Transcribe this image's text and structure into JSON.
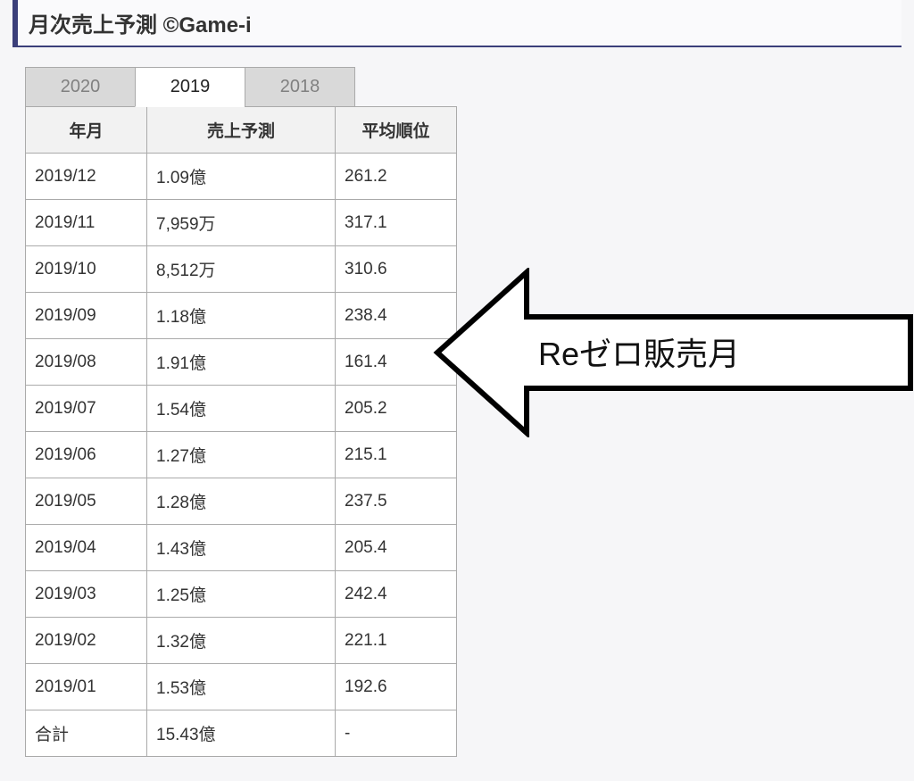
{
  "title": "月次売上予測 ©Game-i",
  "tabs": [
    {
      "label": "2020",
      "active": false
    },
    {
      "label": "2019",
      "active": true
    },
    {
      "label": "2018",
      "active": false
    }
  ],
  "headers": {
    "ym": "年月",
    "sales": "売上予測",
    "rank": "平均順位"
  },
  "rows": [
    {
      "ym": "2019/12",
      "sales": "1.09億",
      "rank": "261.2",
      "hl": true
    },
    {
      "ym": "2019/11",
      "sales": "7,959万",
      "rank": "317.1",
      "hl": true
    },
    {
      "ym": "2019/10",
      "sales": "8,512万",
      "rank": "310.6",
      "hl": true
    },
    {
      "ym": "2019/09",
      "sales": "1.18億",
      "rank": "238.4",
      "hl": true
    },
    {
      "ym": "2019/08",
      "sales": "1.91億",
      "rank": "161.4",
      "hl": true
    },
    {
      "ym": "2019/07",
      "sales": "1.54億",
      "rank": "205.2",
      "hl": true
    },
    {
      "ym": "2019/06",
      "sales": "1.27億",
      "rank": "215.1",
      "hl": true
    },
    {
      "ym": "2019/05",
      "sales": "1.28億",
      "rank": "237.5",
      "hl": false
    },
    {
      "ym": "2019/04",
      "sales": "1.43億",
      "rank": "205.4",
      "hl": true
    },
    {
      "ym": "2019/03",
      "sales": "1.25億",
      "rank": "242.4",
      "hl": true
    },
    {
      "ym": "2019/02",
      "sales": "1.32億",
      "rank": "221.1",
      "hl": false
    },
    {
      "ym": "2019/01",
      "sales": "1.53億",
      "rank": "192.6",
      "hl": true
    }
  ],
  "total": {
    "ym": "合計",
    "sales": "15.43億",
    "rank": "-"
  },
  "callout": "Reゼロ販売月"
}
